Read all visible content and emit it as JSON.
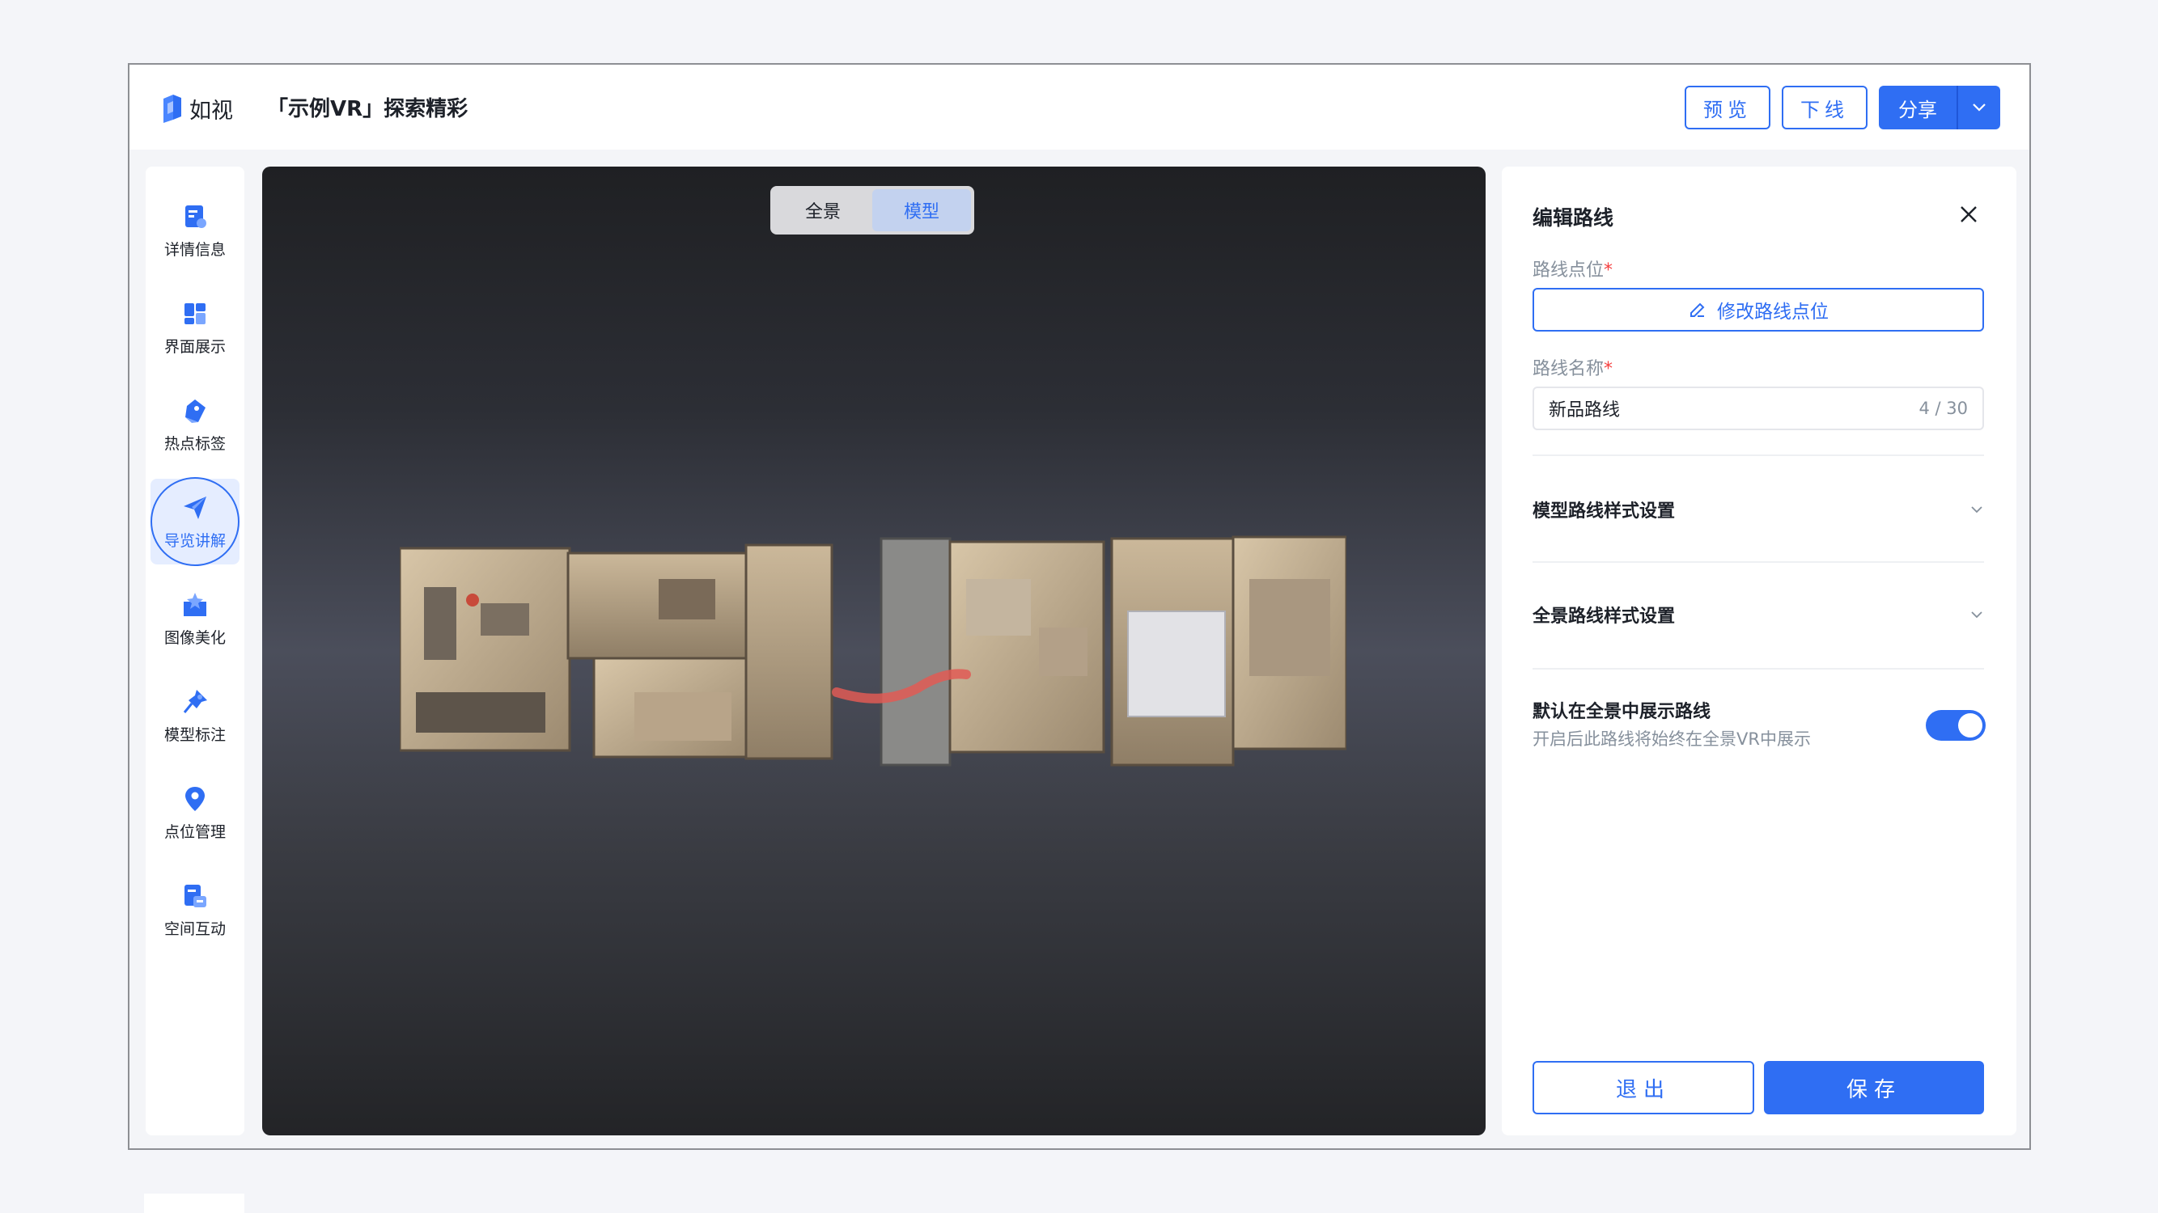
{
  "app": {
    "logo_text": "如视",
    "title": "「示例VR」探索精彩"
  },
  "top_actions": {
    "preview": "预览",
    "offline": "下线",
    "share": "分享"
  },
  "sidebar": {
    "items": [
      {
        "label": "详情信息",
        "icon": "details-icon"
      },
      {
        "label": "界面展示",
        "icon": "interface-icon"
      },
      {
        "label": "热点标签",
        "icon": "hotspot-tag-icon"
      },
      {
        "label": "导览讲解",
        "icon": "navigation-arrow-icon",
        "active": true
      },
      {
        "label": "图像美化",
        "icon": "image-enhance-icon"
      },
      {
        "label": "模型标注",
        "icon": "pin-icon"
      },
      {
        "label": "点位管理",
        "icon": "location-icon"
      },
      {
        "label": "空间互动",
        "icon": "space-interaction-icon"
      }
    ]
  },
  "viewport": {
    "toggle": {
      "panorama": "全景",
      "model": "模型",
      "active": "模型"
    }
  },
  "panel": {
    "title": "编辑路线",
    "points_label": "路线点位",
    "required_mark": "*",
    "edit_points_button": "修改路线点位",
    "name_label": "路线名称",
    "name_value": "新品路线",
    "name_counter": "4 / 30",
    "model_style_section": "模型路线样式设置",
    "panorama_style_section": "全景路线样式设置",
    "default_show_title": "默认在全景中展示路线",
    "default_show_desc": "开启后此路线将始终在全景VR中展示",
    "default_show_enabled": true,
    "exit_button": "退出",
    "save_button": "保存"
  },
  "colors": {
    "accent": "#2f6ef3",
    "required": "#f53f3f",
    "muted_text": "#86909c"
  }
}
